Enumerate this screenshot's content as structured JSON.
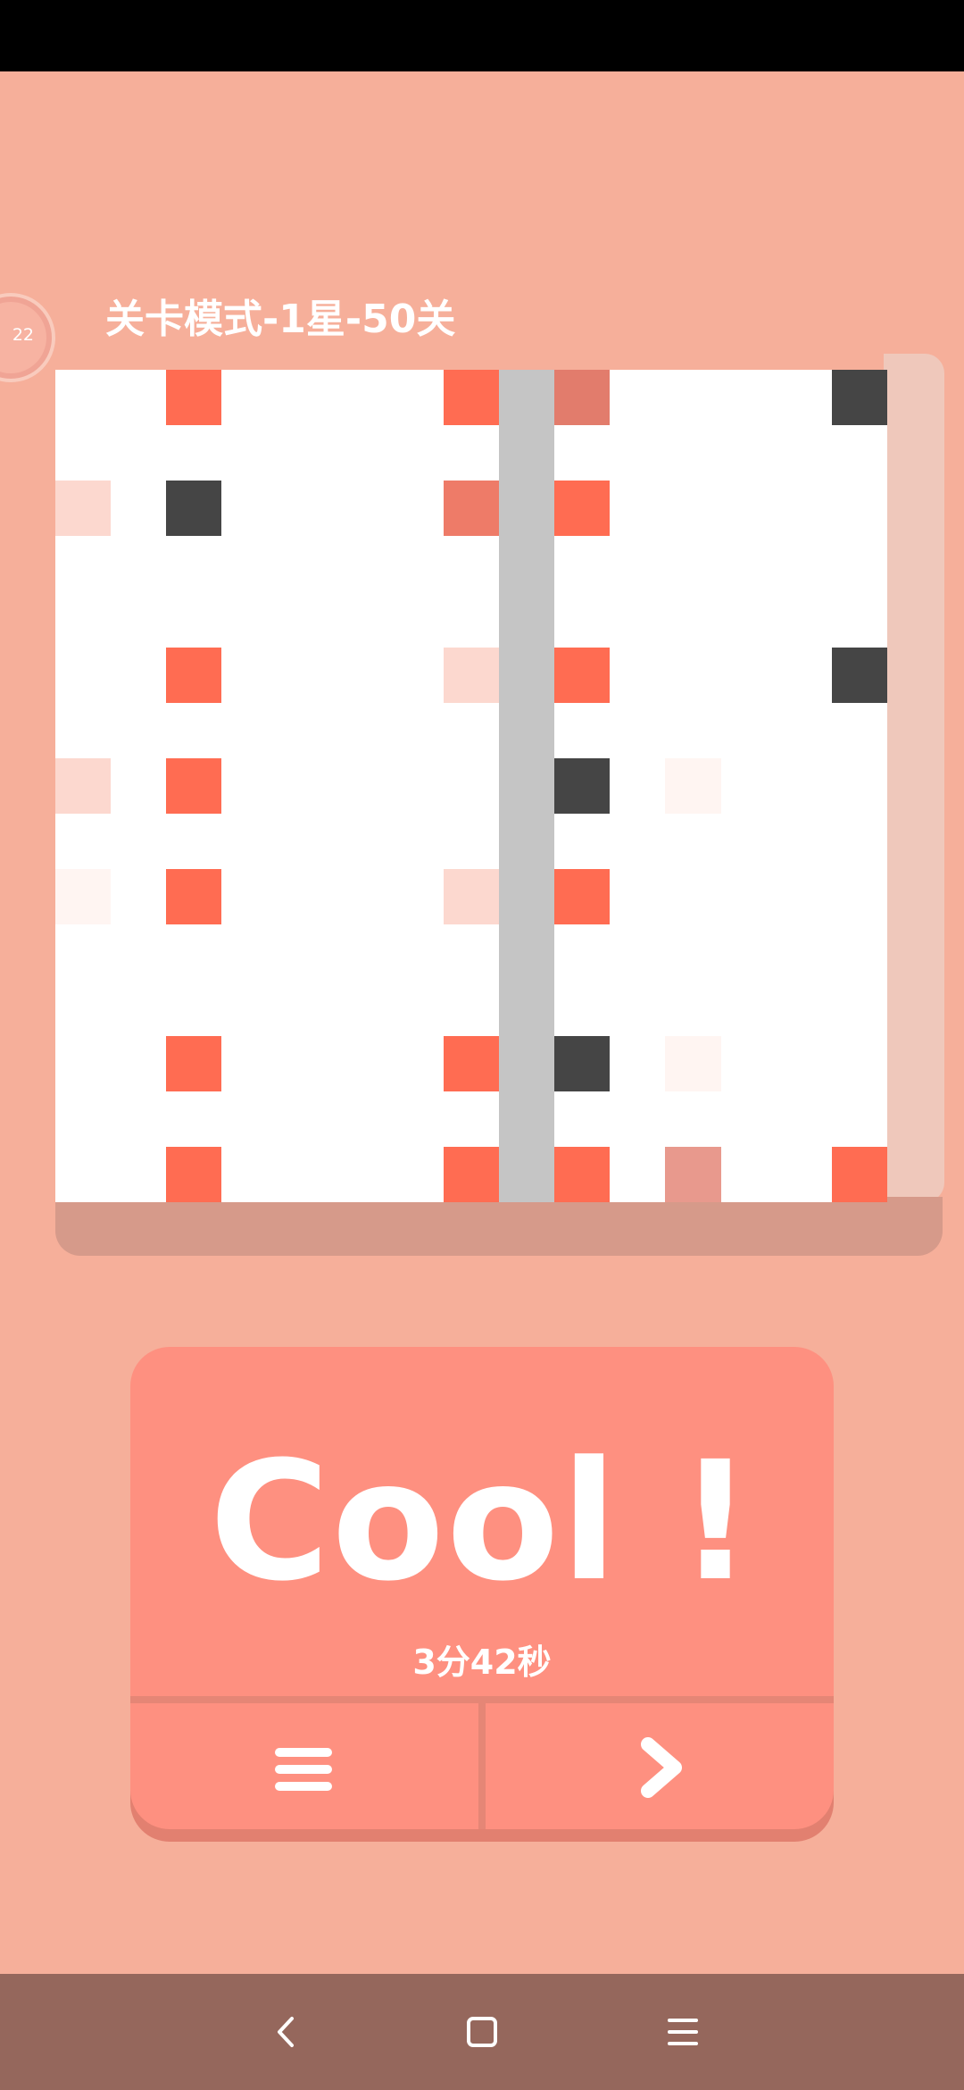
{
  "game": {
    "timer_badge": "22",
    "level_title": "关卡模式-1星-50关",
    "result_text": "Cool !",
    "elapsed_time": "3分42秒"
  },
  "colors": {
    "background": "#f6af9a",
    "board": "#ffffff",
    "coral_tile": "#ff6c52",
    "dark_tile": "#454545",
    "divider": "#c5c5c5",
    "card": "#fe9080",
    "nav_bar": "#95675c"
  },
  "board": {
    "columns": 15,
    "rows": 15,
    "tiles": [
      {
        "row": 0,
        "col": 2,
        "type": "coral"
      },
      {
        "row": 0,
        "col": 7,
        "type": "coral"
      },
      {
        "row": 0,
        "col": 9,
        "type": "coral-muted"
      },
      {
        "row": 0,
        "col": 14,
        "type": "dark"
      },
      {
        "row": 2,
        "col": 0,
        "type": "coral-faint"
      },
      {
        "row": 2,
        "col": 2,
        "type": "dark"
      },
      {
        "row": 2,
        "col": 7,
        "type": "coral-soft"
      },
      {
        "row": 2,
        "col": 9,
        "type": "coral"
      },
      {
        "row": 5,
        "col": 2,
        "type": "coral"
      },
      {
        "row": 5,
        "col": 7,
        "type": "coral-faint"
      },
      {
        "row": 5,
        "col": 9,
        "type": "coral"
      },
      {
        "row": 5,
        "col": 14,
        "type": "dark"
      },
      {
        "row": 7,
        "col": 0,
        "type": "coral-faint"
      },
      {
        "row": 7,
        "col": 2,
        "type": "coral"
      },
      {
        "row": 7,
        "col": 9,
        "type": "dark"
      },
      {
        "row": 7,
        "col": 11,
        "type": "ghost"
      },
      {
        "row": 9,
        "col": 0,
        "type": "ghost"
      },
      {
        "row": 9,
        "col": 2,
        "type": "coral"
      },
      {
        "row": 9,
        "col": 7,
        "type": "coral-faint"
      },
      {
        "row": 9,
        "col": 9,
        "type": "coral"
      },
      {
        "row": 12,
        "col": 2,
        "type": "coral"
      },
      {
        "row": 12,
        "col": 7,
        "type": "coral"
      },
      {
        "row": 12,
        "col": 9,
        "type": "dark"
      },
      {
        "row": 12,
        "col": 11,
        "type": "ghost"
      },
      {
        "row": 14,
        "col": 2,
        "type": "coral"
      },
      {
        "row": 14,
        "col": 7,
        "type": "coral"
      },
      {
        "row": 14,
        "col": 9,
        "type": "coral"
      },
      {
        "row": 14,
        "col": 11,
        "type": "coral-pale"
      },
      {
        "row": 14,
        "col": 14,
        "type": "coral"
      }
    ],
    "divider_col": 8
  },
  "actions": {
    "menu_icon": "menu-icon",
    "next_icon": "chevron-right-icon"
  },
  "nav": {
    "back_icon": "back-icon",
    "home_icon": "home-icon",
    "recents_icon": "recents-icon"
  }
}
